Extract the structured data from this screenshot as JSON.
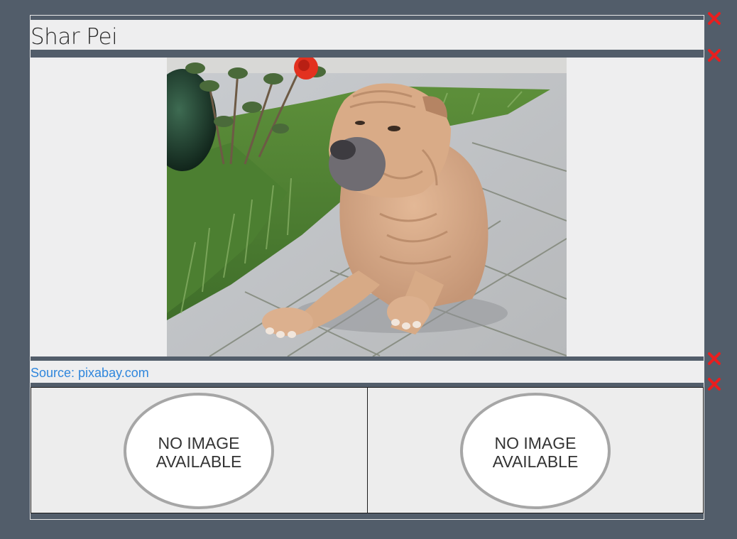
{
  "article": {
    "title": "Shar Pei",
    "photo": {
      "subject": "shar pei dog lying on paving stones"
    },
    "source": {
      "label": "Source: pixabay.com"
    },
    "placeholders": [
      {
        "line1": "NO IMAGE",
        "line2": "AVAILABLE"
      },
      {
        "line1": "NO IMAGE",
        "line2": "AVAILABLE"
      }
    ]
  },
  "controls": {
    "close_icon": "close-icon",
    "close_color": "#ea1e1e"
  },
  "colors": {
    "background": "#525d6a",
    "panel": "#eeeeef",
    "link": "#2f86dc"
  }
}
